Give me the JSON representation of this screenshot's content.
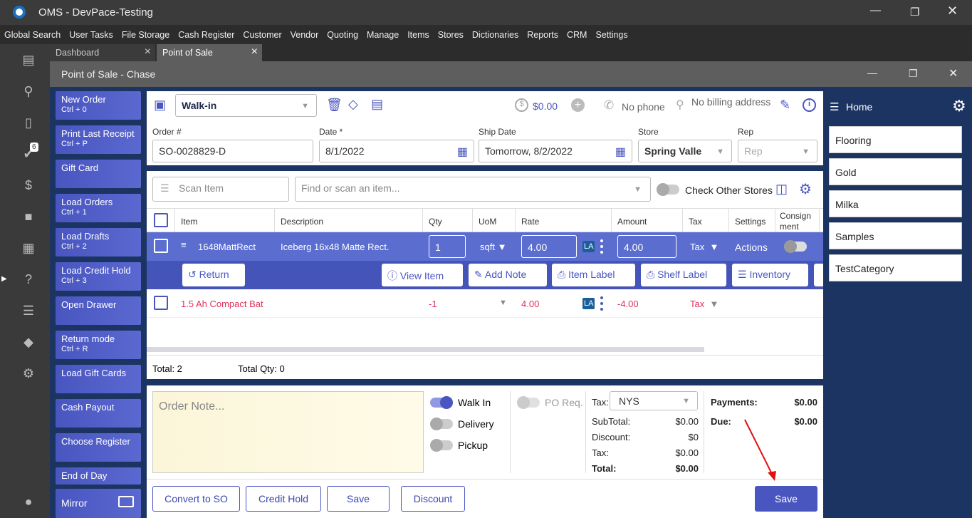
{
  "app": {
    "title": "OMS - DevPace-Testing"
  },
  "menu": [
    "Global Search",
    "User Tasks",
    "File Storage",
    "Cash Register",
    "Customer",
    "Vendor",
    "Quoting",
    "Manage",
    "Items",
    "Stores",
    "Dictionaries",
    "Reports",
    "CRM",
    "Settings"
  ],
  "sidebar": {
    "tasks_badge": "6"
  },
  "tabs": [
    {
      "label": "Dashboard"
    },
    {
      "label": "Point of Sale"
    }
  ],
  "window": {
    "title": "Point of Sale - Chase"
  },
  "actions": [
    {
      "label": "New Order",
      "shortcut": "Ctrl + 0"
    },
    {
      "label": "Print Last Receipt",
      "shortcut": "Ctrl + P"
    },
    {
      "label": "Gift Card",
      "shortcut": ""
    },
    {
      "label": "Load Orders",
      "shortcut": "Ctrl + 1"
    },
    {
      "label": "Load Drafts",
      "shortcut": "Ctrl + 2"
    },
    {
      "label": "Load Credit Hold",
      "shortcut": "Ctrl + 3"
    },
    {
      "label": "Open Drawer",
      "shortcut": ""
    },
    {
      "label": "Return mode",
      "shortcut": "Ctrl + R"
    },
    {
      "label": "Load Gift Cards",
      "shortcut": ""
    },
    {
      "label": "Cash Payout",
      "shortcut": ""
    },
    {
      "label": "Choose Register",
      "shortcut": ""
    },
    {
      "label": "End of Day",
      "shortcut": ""
    },
    {
      "label": "Mirror",
      "shortcut": ""
    }
  ],
  "header": {
    "customer": "Walk-in",
    "balance": "$0.00",
    "phone": "No phone",
    "billing": "No billing address",
    "order_label": "Order #",
    "order": "SO-0028829-D",
    "date_label": "Date *",
    "date": "8/1/2022",
    "ship_label": "Ship Date",
    "ship": "Tomorrow, 8/2/2022",
    "store_label": "Store",
    "store": "Spring Valle",
    "rep_label": "Rep",
    "rep_placeholder": "Rep"
  },
  "search": {
    "scan_placeholder": "Scan Item",
    "find_placeholder": "Find or scan an item...",
    "check_other": "Check Other Stores"
  },
  "columns": [
    "Item",
    "Description",
    "Qty",
    "UoM",
    "Rate",
    "Amount",
    "Tax",
    "Settings",
    "Consign ment"
  ],
  "rows": [
    {
      "item": "1648MattRect",
      "description": "Iceberg 16x48 Matte Rect.",
      "qty": "1",
      "uom": "sqft",
      "rate": "4.00",
      "la": "LA",
      "amount": "4.00",
      "tax": "Tax",
      "settings": "Actions"
    },
    {
      "item": "1.5 Ah Compact Bat",
      "description": "",
      "qty": "-1",
      "uom": "",
      "rate": "4.00",
      "la": "LA",
      "amount": "-4.00",
      "tax": "Tax",
      "settings": ""
    }
  ],
  "row_actions": [
    "Return",
    "View Item",
    "Add Note",
    "Item Label",
    "Shelf Label",
    "Inventory"
  ],
  "totals": {
    "total": "Total: 2",
    "total_qty": "Total Qty: 0"
  },
  "note_placeholder": "Order Note...",
  "delivery": {
    "walk_in": "Walk In",
    "delivery": "Delivery",
    "pickup": "Pickup",
    "po_req": "PO Req."
  },
  "summary": {
    "tax_label": "Tax:",
    "tax_code": "NYS",
    "subtotal_label": "SubTotal:",
    "subtotal": "$0.00",
    "discount_label": "Discount:",
    "discount": "$0",
    "tax2_label": "Tax:",
    "tax": "$0.00",
    "total_label": "Total:",
    "total": "$0.00",
    "payments_label": "Payments:",
    "payments": "$0.00",
    "due_label": "Due:",
    "due": "$0.00"
  },
  "bottom_buttons": [
    "Convert to SO",
    "Credit Hold",
    "Save",
    "Discount"
  ],
  "save_label": "Save",
  "right": {
    "home": "Home",
    "categories": [
      "Flooring",
      "Gold",
      "Milka",
      "Samples",
      "TestCategory"
    ]
  },
  "colors": {
    "accent": "#4a56c0",
    "navy": "#1c3462",
    "error": "#e0305a"
  }
}
